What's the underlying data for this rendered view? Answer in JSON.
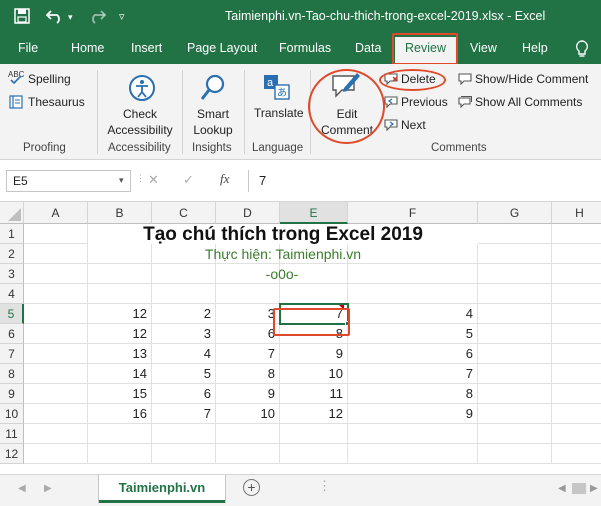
{
  "window": {
    "title": "Taimienphi.vn-Tao-chu-thich-trong-excel-2019.xlsx  -  Excel"
  },
  "tabs": [
    "File",
    "Home",
    "Insert",
    "Page Layout",
    "Formulas",
    "Data",
    "Review",
    "View",
    "Help"
  ],
  "active_tab": "Review",
  "ribbon": {
    "proofing": {
      "spelling": "Spelling",
      "thesaurus": "Thesaurus",
      "label": "Proofing"
    },
    "accessibility": {
      "check_line1": "Check",
      "check_line2": "Accessibility",
      "label": "Accessibility"
    },
    "insights": {
      "smart_line1": "Smart",
      "smart_line2": "Lookup",
      "label": "Insights"
    },
    "language": {
      "translate": "Translate",
      "label": "Language"
    },
    "comments": {
      "edit_line1": "Edit",
      "edit_line2": "Comment",
      "delete": "Delete",
      "previous": "Previous",
      "next": "Next",
      "show_hide": "Show/Hide Comment",
      "show_all": "Show All Comments",
      "label": "Comments"
    }
  },
  "formula_bar": {
    "name_box": "E5",
    "cancel": "✕",
    "enter": "✓",
    "fx": "fx",
    "value": "7"
  },
  "sheet": {
    "columns": [
      "A",
      "B",
      "C",
      "D",
      "E",
      "F",
      "G",
      "H"
    ],
    "selected_column": "E",
    "rows": [
      "1",
      "2",
      "3",
      "4",
      "5",
      "6",
      "7",
      "8",
      "9",
      "10",
      "11",
      "12"
    ],
    "selected_row": "5",
    "title": "Tạo chú thích trong Excel 2019",
    "subtitle": "Thực hiện: Taimienphi.vn",
    "tagline": "-o0o-",
    "data": [
      [
        "12",
        "2",
        "3",
        "7",
        "4"
      ],
      [
        "12",
        "3",
        "6",
        "8",
        "5"
      ],
      [
        "13",
        "4",
        "7",
        "9",
        "6"
      ],
      [
        "14",
        "5",
        "8",
        "10",
        "7"
      ],
      [
        "15",
        "6",
        "9",
        "11",
        "8"
      ],
      [
        "16",
        "7",
        "10",
        "12",
        "9"
      ]
    ]
  },
  "sheet_tabs": {
    "active": "Taimienphi.vn",
    "add": "+"
  },
  "colors": {
    "excel_green": "#217346",
    "annotation_red": "#e04a2a",
    "accent_text": "#3a7d2c"
  }
}
